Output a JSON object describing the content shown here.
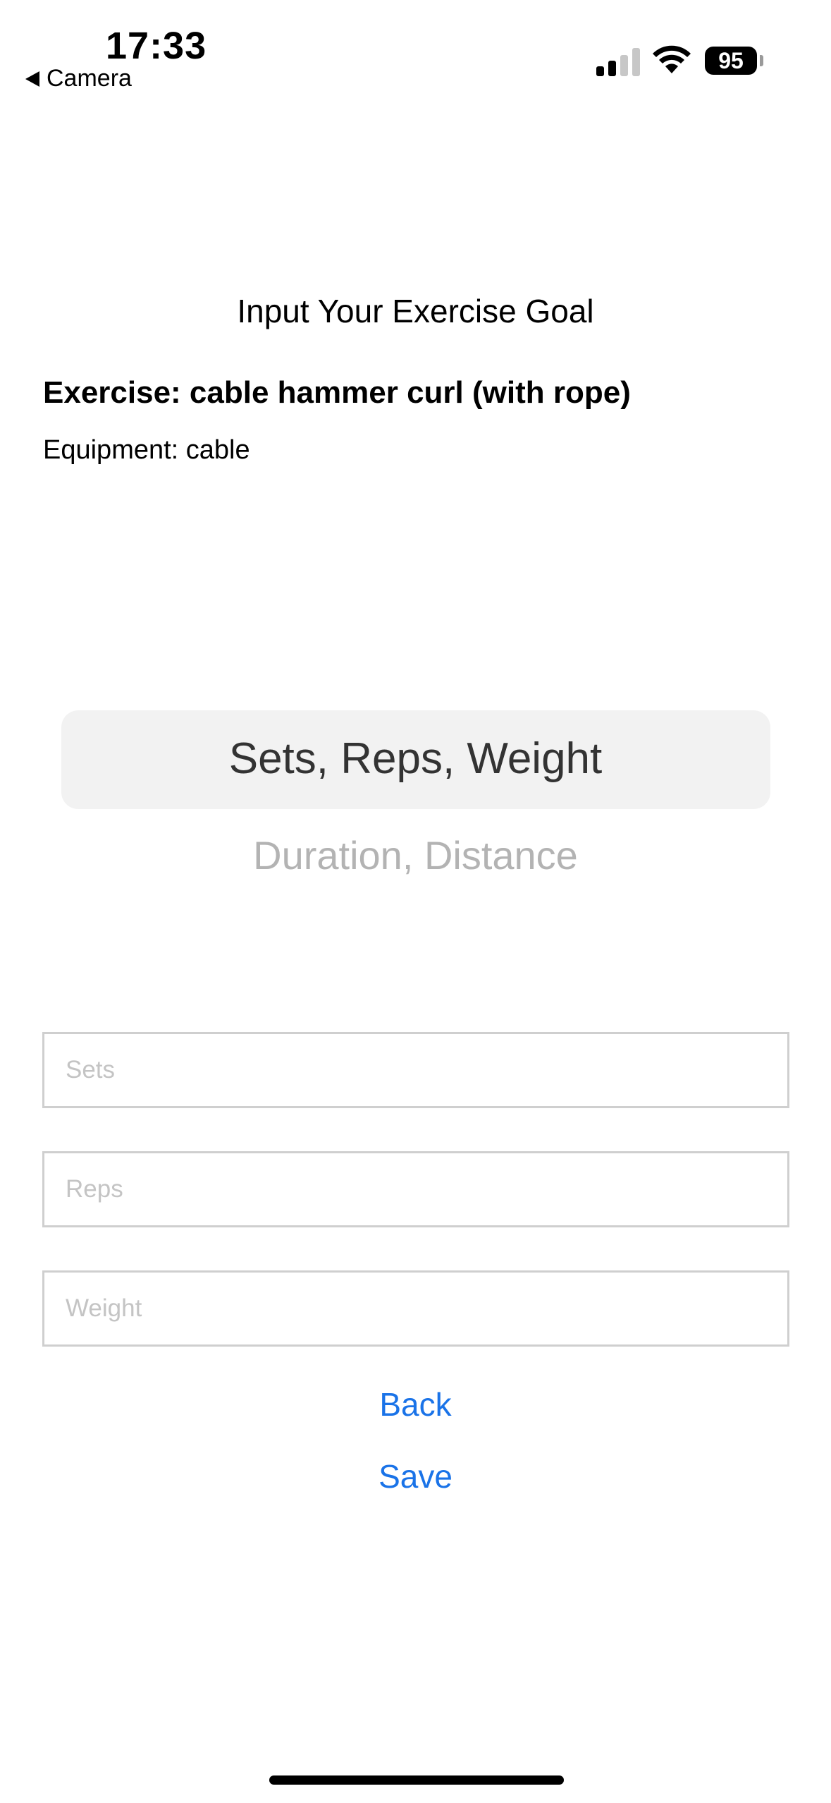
{
  "status_bar": {
    "time": "17:33",
    "back_app_label": "Camera",
    "battery": "95",
    "icons": [
      "back-triangle-icon",
      "cellular-signal-icon",
      "wifi-icon",
      "battery-icon"
    ]
  },
  "header": {
    "title": "Input Your Exercise Goal"
  },
  "exercise": {
    "name": "Exercise: cable hammer curl (with rope)",
    "equipment": "Equipment: cable"
  },
  "picker": {
    "selected": "Sets, Reps, Weight",
    "options": [
      "Sets, Reps, Weight",
      "Duration, Distance"
    ]
  },
  "form": {
    "sets_placeholder": "Sets",
    "reps_placeholder": "Reps",
    "weight_placeholder": "Weight"
  },
  "actions": {
    "back_label": "Back",
    "save_label": "Save"
  },
  "colors": {
    "accent": "#1a73e8",
    "picker_highlight": "#f2f2f2",
    "field_border": "#cfcfcf"
  }
}
